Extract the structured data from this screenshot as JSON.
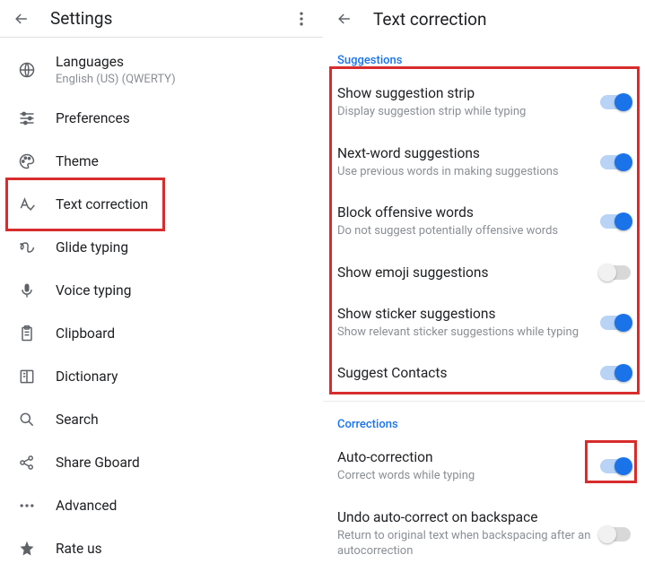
{
  "left": {
    "title": "Settings",
    "items": [
      {
        "label": "Languages",
        "sub": "English (US) (QWERTY)"
      },
      {
        "label": "Preferences"
      },
      {
        "label": "Theme"
      },
      {
        "label": "Text correction"
      },
      {
        "label": "Glide typing"
      },
      {
        "label": "Voice typing"
      },
      {
        "label": "Clipboard"
      },
      {
        "label": "Dictionary"
      },
      {
        "label": "Search"
      },
      {
        "label": "Share Gboard"
      },
      {
        "label": "Advanced"
      },
      {
        "label": "Rate us"
      }
    ]
  },
  "right": {
    "title": "Text correction",
    "sections": {
      "suggestions": {
        "header": "Suggestions",
        "items": [
          {
            "label": "Show suggestion strip",
            "sub": "Display suggestion strip while typing",
            "on": true
          },
          {
            "label": "Next-word suggestions",
            "sub": "Use previous words in making suggestions",
            "on": true
          },
          {
            "label": "Block offensive words",
            "sub": "Do not suggest potentially offensive words",
            "on": true
          },
          {
            "label": "Show emoji suggestions",
            "on": false
          },
          {
            "label": "Show sticker suggestions",
            "sub": "Show relevant sticker suggestions while typing",
            "on": true
          },
          {
            "label": "Suggest Contacts",
            "on": true
          }
        ]
      },
      "corrections": {
        "header": "Corrections",
        "items": [
          {
            "label": "Auto-correction",
            "sub": "Correct words while typing",
            "on": true
          },
          {
            "label": "Undo auto-correct on backspace",
            "sub": "Return to original text when backspacing after an autocorrection",
            "on": false
          }
        ]
      }
    }
  }
}
